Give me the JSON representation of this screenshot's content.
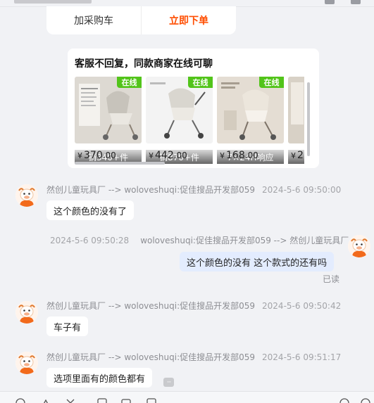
{
  "colors": {
    "accent_orange": "#ff4d00",
    "online_green": "#52c41a",
    "outgoing_bubble": "#e3ecfe",
    "incoming_bubble": "#ffffff",
    "page_bg": "#f1f2f5"
  },
  "action_card": {
    "add_to_cart_label": "加采购车",
    "order_now_label": "立即下单"
  },
  "recommendation": {
    "title": "客服不回复，同款商家在线可聊",
    "online_badge": "在线",
    "currency_symbol": "¥",
    "products": [
      {
        "sold": "销340+件",
        "price": "370",
        "price_decimal": ".00"
      },
      {
        "sold": "销870+件",
        "price": "442",
        "price_decimal": ".00"
      },
      {
        "sold": "7×24H响应",
        "price": "168",
        "price_decimal": ".00"
      },
      {
        "sold": "回",
        "price": "2",
        "price_decimal": ""
      }
    ]
  },
  "messages": [
    {
      "direction": "in",
      "sender": "然创儿童玩具厂 --> woloveshuqi:促佳搜品开发部059",
      "time": "2024-5-6 09:50:00",
      "text": "这个颜色的没有了"
    },
    {
      "direction": "out",
      "sender": "woloveshuqi:促佳搜品开发部059 --> 然创儿童玩具厂",
      "time": "2024-5-6 09:50:28",
      "text": "这个颜色的没有  这个款式的还有吗",
      "status": "已读"
    },
    {
      "direction": "in",
      "sender": "然创儿童玩具厂 --> woloveshuqi:促佳搜品开发部059",
      "time": "2024-5-6 09:50:42",
      "text": "车子有"
    },
    {
      "direction": "in",
      "sender": "然创儿童玩具厂 --> woloveshuqi:促佳搜品开发部059",
      "time": "2024-5-6 09:51:17",
      "text": "选项里面有的颜色都有"
    }
  ],
  "more_indicator": "···"
}
